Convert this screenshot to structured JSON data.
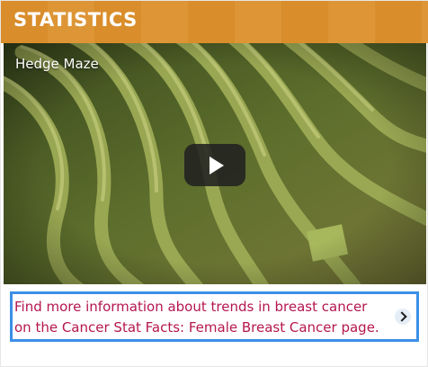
{
  "header": {
    "title": "STATISTICS"
  },
  "video": {
    "title": "Hedge Maze",
    "play_icon": "play-icon"
  },
  "info_link": {
    "text": "Find more information about trends in breast cancer on the Cancer Stat Facts: Female Breast Cancer page.",
    "icon": "chevron-right-icon"
  },
  "colors": {
    "header_bg": "#d98d2b",
    "link_text": "#b5164f",
    "focus_border": "#3c8fe6"
  }
}
